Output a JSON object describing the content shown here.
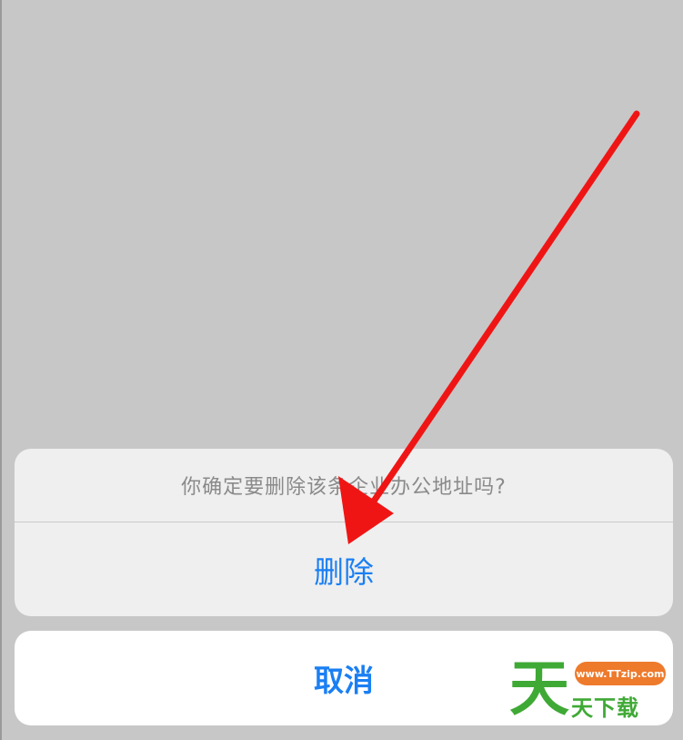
{
  "dialog": {
    "message": "你确定要删除该条企业办公地址吗?",
    "delete_label": "删除",
    "cancel_label": "取消"
  },
  "annotation": {
    "arrow_color": "#f01515"
  },
  "watermark": {
    "big_char": "天",
    "url": "www.TTzip.com",
    "text": "天下载"
  },
  "colors": {
    "overlay": "#c7c7c7",
    "action_blue": "#1a7ff3",
    "sheet_bg": "#efefef",
    "cancel_bg": "#ffffff"
  }
}
